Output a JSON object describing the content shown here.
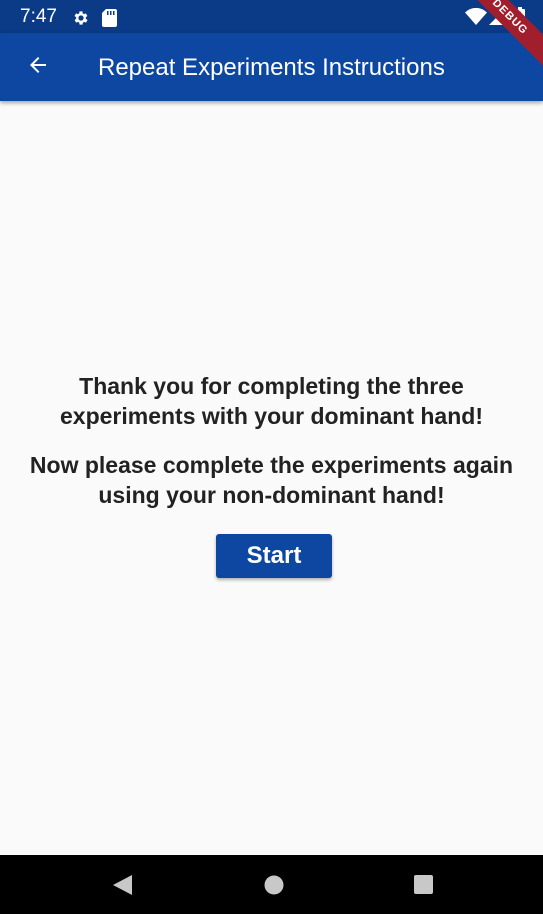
{
  "status_bar": {
    "time": "7:47",
    "icons": [
      "settings-icon",
      "sd-card-icon",
      "wifi-icon",
      "signal-icon",
      "battery-charging-icon"
    ]
  },
  "app_bar": {
    "title": "Repeat Experiments Instructions",
    "back_icon": "arrow-back-icon",
    "debug_banner": "DEBUG"
  },
  "main": {
    "message_line1": "Thank you for completing the three",
    "message_line2": "experiments with your dominant hand!",
    "message_line3": "Now please complete the experiments again",
    "message_line4": "using your non-dominant hand!",
    "start_label": "Start"
  },
  "nav_bar": {
    "buttons": [
      "back-triangle-icon",
      "home-circle-icon",
      "recents-square-icon"
    ]
  },
  "colors": {
    "app_bar": "#0d47a1",
    "status_bar": "#0b3a86",
    "button": "#0d47a1",
    "background": "#fafafa",
    "debug_banner": "#a11e2c"
  }
}
